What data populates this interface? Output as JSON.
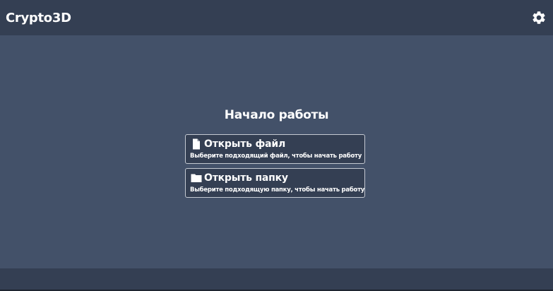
{
  "app": {
    "title": "Crypto3D",
    "settings_icon": "gear-icon"
  },
  "main": {
    "heading": "Начало работы",
    "actions": [
      {
        "icon": "file-icon",
        "title": "Открыть файл",
        "description": "Выберите подходящий файл, чтобы начать работу"
      },
      {
        "icon": "folder-icon",
        "title": "Открыть папку",
        "description": "Выберите подходящую папку, чтобы начать работу"
      }
    ]
  },
  "colors": {
    "background": "#435169",
    "bars": "#343f53",
    "card_border": "#c4c9d2",
    "text": "#ffffff"
  }
}
